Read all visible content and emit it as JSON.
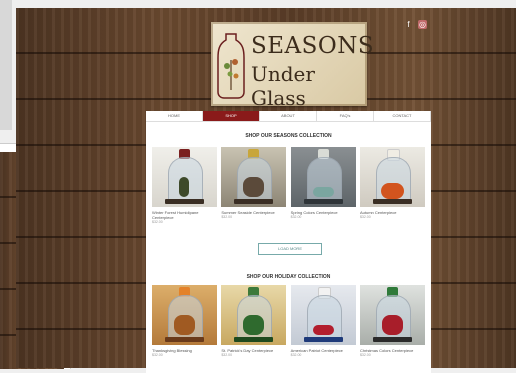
{
  "logo": {
    "line1": "SEASONS",
    "line2": "Under Glass"
  },
  "social": {
    "facebook_glyph": "f",
    "instagram_glyph": "◎"
  },
  "nav": [
    "HOME",
    "SHOP",
    "ABOUT",
    "FAQ's",
    "CONTACT"
  ],
  "active_nav_index": 1,
  "seasons": {
    "title": "SHOP OUR SEASONS COLLECTION",
    "items": [
      {
        "name": "Winter Forest Humidipane Centerpiece",
        "price": "$32.00"
      },
      {
        "name": "Summer Seaside Centerpiece",
        "price": "$32.00"
      },
      {
        "name": "Spring Colors Centerpiece",
        "price": "$32.00"
      },
      {
        "name": "Autumn Centerpiece",
        "price": "$32.00"
      }
    ]
  },
  "load_more": "LOAD MORE",
  "holiday": {
    "title": "SHOP OUR HOLIDAY COLLECTION",
    "items": [
      {
        "name": "Thanksgiving Blessing",
        "price": "$32.00"
      },
      {
        "name": "St. Patrick's Day Centerpiece",
        "price": "$32.00"
      },
      {
        "name": "American Patriot Centerpiece",
        "price": "$32.00"
      },
      {
        "name": "Christmas Colors Centerpiece",
        "price": "$32.00"
      }
    ]
  },
  "colors": {
    "accent": "#8a1a1a",
    "load_more": "#5a8a8a"
  }
}
